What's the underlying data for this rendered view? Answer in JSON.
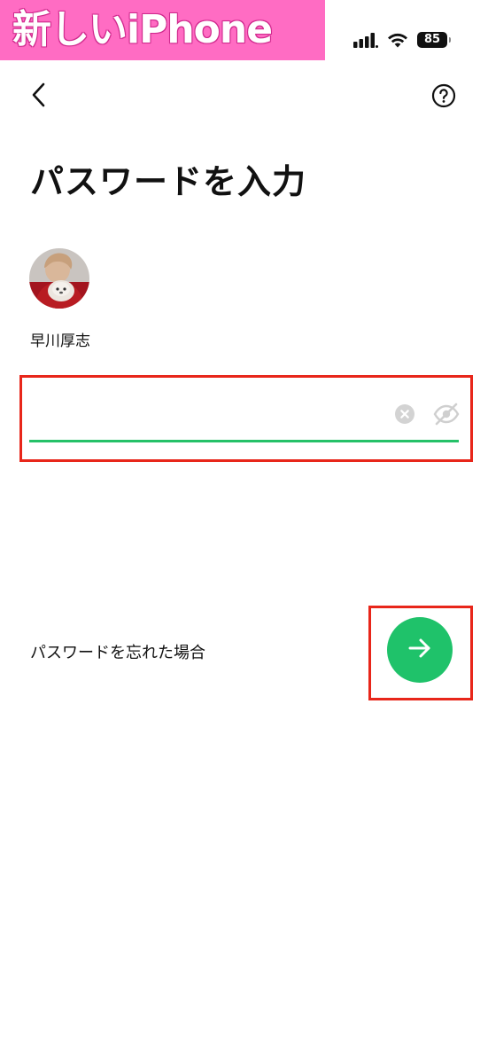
{
  "overlay_tag": "新しいiPhone",
  "status_bar": {
    "battery_level": "85"
  },
  "header": {
    "back_icon": "chevron-left-icon",
    "help_icon": "question-circle-icon"
  },
  "title": "パスワードを入力",
  "user": {
    "name": "早川厚志"
  },
  "password_field": {
    "value": "",
    "clear_icon": "clear-circle-icon",
    "visibility_icon": "eye-off-icon",
    "underline_color": "#25c168"
  },
  "forgot_password_label": "パスワードを忘れた場合",
  "next_button": {
    "icon": "arrow-right-icon",
    "color": "#1fc26a"
  },
  "highlight_color": "#e8261a"
}
